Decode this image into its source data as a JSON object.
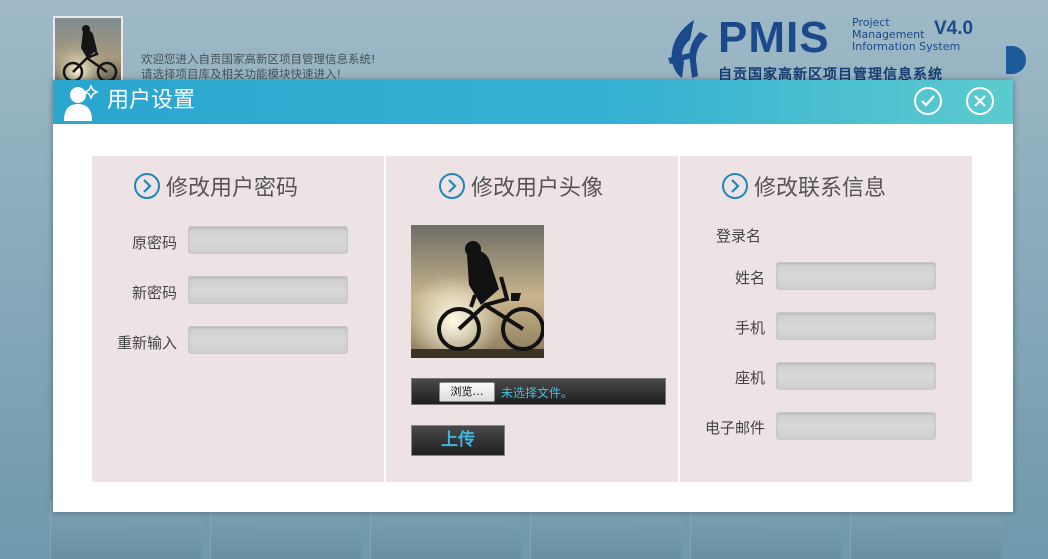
{
  "header": {
    "welcome_line1": "欢迎您进入自贡国家高新区项目管理信息系统!",
    "welcome_line2": "请选择项目库及相关功能模块快速进入!",
    "logo_title": "PMIS",
    "logo_sub_line1": "Project",
    "logo_sub_line2": "Management",
    "logo_sub_line3": "Information System",
    "logo_version": "V4.0",
    "logo_cn": "自贡国家高新区项目管理信息系统",
    "brand_color": "#1b4a8c"
  },
  "dialog": {
    "title": "用户设置",
    "icons": {
      "user": "user-icon",
      "ok": "check-icon",
      "close": "close-icon"
    },
    "header_color": "#2aa6cf"
  },
  "password_panel": {
    "title": "修改用户密码",
    "fields": [
      {
        "label": "原密码",
        "value": ""
      },
      {
        "label": "新密码",
        "value": ""
      },
      {
        "label": "重新输入",
        "value": ""
      }
    ]
  },
  "avatar_panel": {
    "title": "修改用户头像",
    "browse_label": "浏览…",
    "file_status": "未选择文件。",
    "upload_label": "上传"
  },
  "contact_panel": {
    "title": "修改联系信息",
    "login_label": "登录名",
    "fields": [
      {
        "label": "姓名",
        "value": ""
      },
      {
        "label": "手机",
        "value": ""
      },
      {
        "label": "座机",
        "value": ""
      },
      {
        "label": "电子邮件",
        "value": ""
      }
    ]
  }
}
